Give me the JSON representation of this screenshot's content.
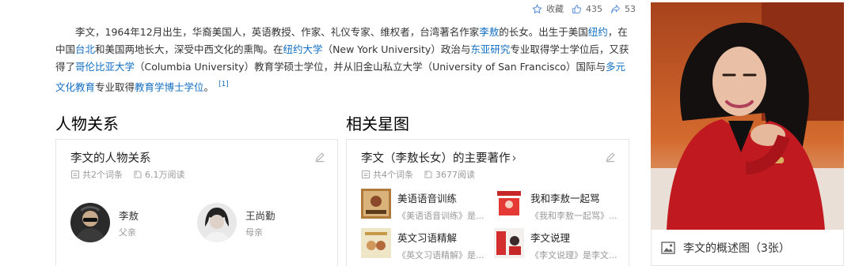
{
  "actions": {
    "favorite_label": "收藏",
    "like_count": "435",
    "share_count": "53"
  },
  "intro": {
    "seg1": "李文，1964年12月出生，华裔美国人，英语教授、作家、礼仪专家、维权者，台湾著名作家",
    "link_liao": "李敖",
    "seg2": "的长女。出生于美国",
    "link_ny": "纽约",
    "seg3": "，在中国",
    "link_taipei": "台北",
    "seg4": "和美国两地长大，深受中西文化的熏陶。在",
    "link_nyu": "纽约大学",
    "seg5": "（New York University）政治与",
    "link_east": "东亚研究",
    "seg6": "专业取得学士学位后，又获得了",
    "link_columbia": "哥伦比亚大学",
    "seg7": "（Columbia University）教育学硕士学位，并从旧金山私立大学（University of San Francisco）国际与",
    "link_multi": "多元文化教育",
    "seg8": "专业取得",
    "link_edd": "教育学博士学位",
    "seg9": "。",
    "ref": "[1]"
  },
  "relations": {
    "section_title": "人物关系",
    "card_title": "李文的人物关系",
    "entries_count": "共2个词条",
    "reads": "6.1万阅读",
    "persons": [
      {
        "name": "李敖",
        "role": "父亲"
      },
      {
        "name": "王尚勤",
        "role": "母亲"
      }
    ]
  },
  "works": {
    "section_title": "相关星图",
    "card_title": "李文（李敖长女）的主要著作",
    "chevron": "›",
    "entries_count": "共4个词条",
    "reads": "3677阅读",
    "items": [
      {
        "title": "美语语音训练",
        "desc": "《美语语音训练》是..."
      },
      {
        "title": "我和李敖一起骂",
        "desc": "《我和李敖一起骂》..."
      },
      {
        "title": "英文习语精解",
        "desc": "《英文习语精解》是..."
      },
      {
        "title": "李文说理",
        "desc": "《李文说理》是李文..."
      }
    ]
  },
  "photo": {
    "caption": "李文的概述图（3张）"
  },
  "colors": {
    "link": "#136ec2",
    "muted": "#999999",
    "border": "#e5e5e5"
  },
  "icons": [
    "star-icon",
    "thumbs-up-icon",
    "share-icon",
    "edit-pencil-icon",
    "entries-icon",
    "book-icon",
    "image-gallery-icon"
  ]
}
